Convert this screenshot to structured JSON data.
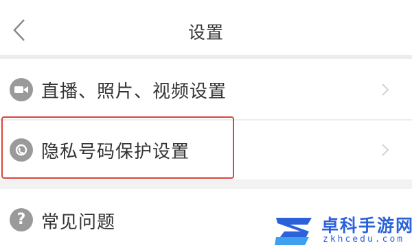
{
  "header": {
    "title": "设置"
  },
  "settings": {
    "items": [
      {
        "label": "直播、照片、视频设置",
        "icon": "video-camera-icon"
      },
      {
        "label": "隐私号码保护设置",
        "icon": "shield-icon"
      }
    ]
  },
  "help": {
    "label": "常见问题",
    "icon": "question-icon"
  },
  "colors": {
    "highlight": "#d9453a",
    "icon_gray": "#9a9a9a",
    "watermark_blue": "#2b62d9"
  },
  "watermark": {
    "title": "卓科手游网",
    "url": "zkhcedu.com"
  }
}
